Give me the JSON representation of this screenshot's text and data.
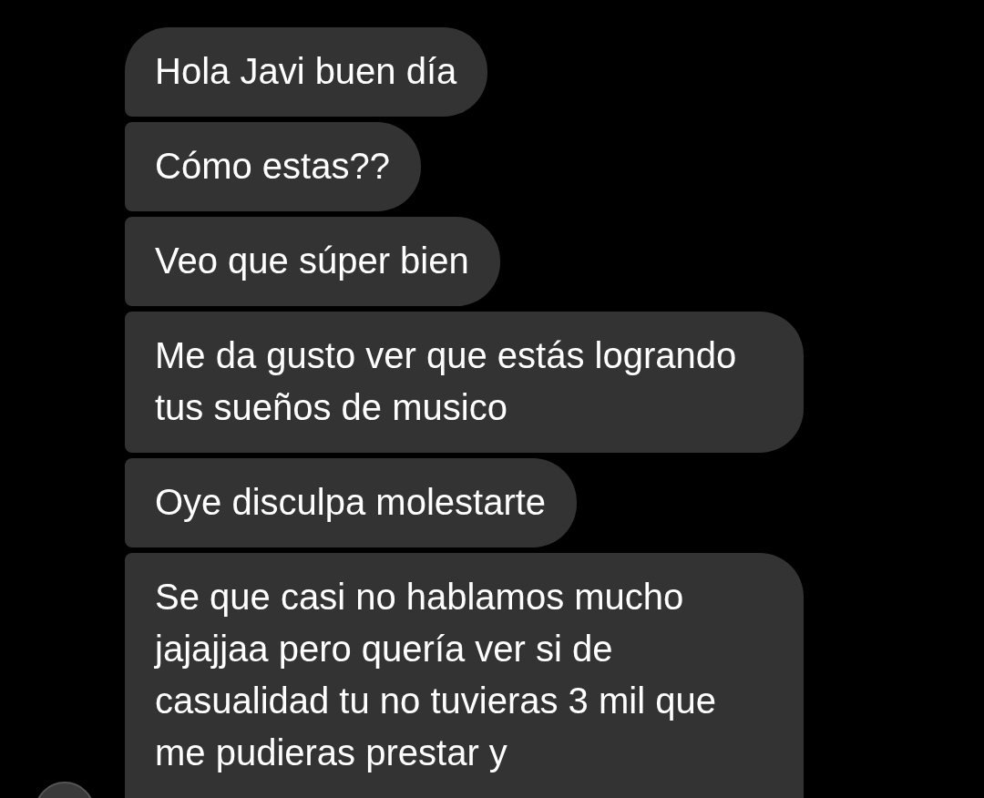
{
  "messages": [
    {
      "text": "Hola Javi buen día"
    },
    {
      "text": "Cómo estas??"
    },
    {
      "text": "Veo que súper bien"
    },
    {
      "text": "Me da gusto ver que estás logrando tus sueños de musico"
    },
    {
      "text": "Oye disculpa molestarte"
    },
    {
      "text": "Se que casi no hablamos mucho jajajjaa pero quería ver si de casualidad tu no tuvieras 3 mil que me pudieras prestar y"
    }
  ]
}
